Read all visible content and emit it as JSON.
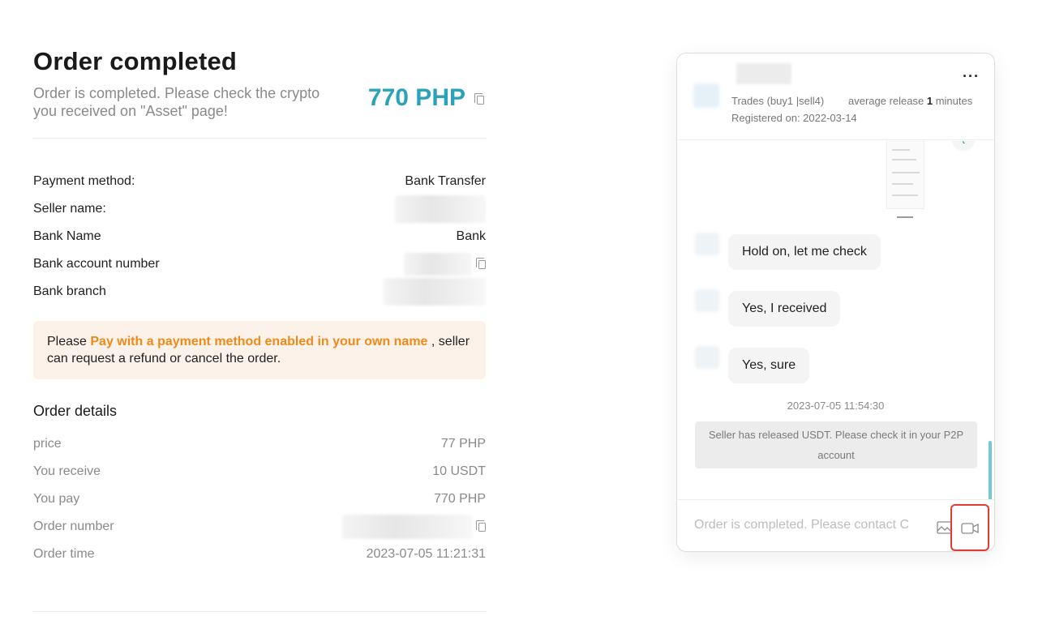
{
  "order": {
    "title": "Order completed",
    "status_message": "Order is completed. Please check the crypto you received on \"Asset\" page!",
    "amount": "770 PHP",
    "payment": [
      {
        "label": "Payment method:",
        "value": "Bank Transfer"
      },
      {
        "label": "Seller name:",
        "value": ""
      },
      {
        "label": "Bank Name",
        "value": "Bank"
      },
      {
        "label": "Bank account number",
        "value": ""
      },
      {
        "label": "Bank branch",
        "value": ""
      }
    ],
    "notice": {
      "prefix": "Please ",
      "highlight": "Pay with a payment method enabled in your own name",
      "suffix": " , seller can request a refund or cancel the order."
    },
    "details_title": "Order details",
    "details": [
      {
        "label": "price",
        "value": "77 PHP"
      },
      {
        "label": "You receive",
        "value": "10 USDT"
      },
      {
        "label": "You pay",
        "value": "770 PHP"
      },
      {
        "label": "Order number",
        "value": ""
      },
      {
        "label": "Order time",
        "value": "2023-07-05 11:21:31"
      }
    ]
  },
  "chat": {
    "more_label": "···",
    "trades": "Trades (buy1 |sell4)",
    "avg_prefix": "average release ",
    "avg_value": "1",
    "avg_suffix": " minutes",
    "registered": "Registered on: 2022-03-14",
    "messages": [
      "Hold on, let me check",
      "Yes, I received",
      "Yes, sure"
    ],
    "timestamp": "2023-07-05 11:54:30",
    "system_message": "Seller has released USDT. Please check it in your P2P account",
    "input_placeholder": "Order is completed. Please contact Customer Service",
    "icons": {
      "image": "image-icon",
      "video": "video-icon",
      "copy": "copy-icon"
    },
    "accent_color": "#2aa3b8",
    "highlight_color": "#ee8a1a",
    "focus_outline_color": "#e53935"
  }
}
